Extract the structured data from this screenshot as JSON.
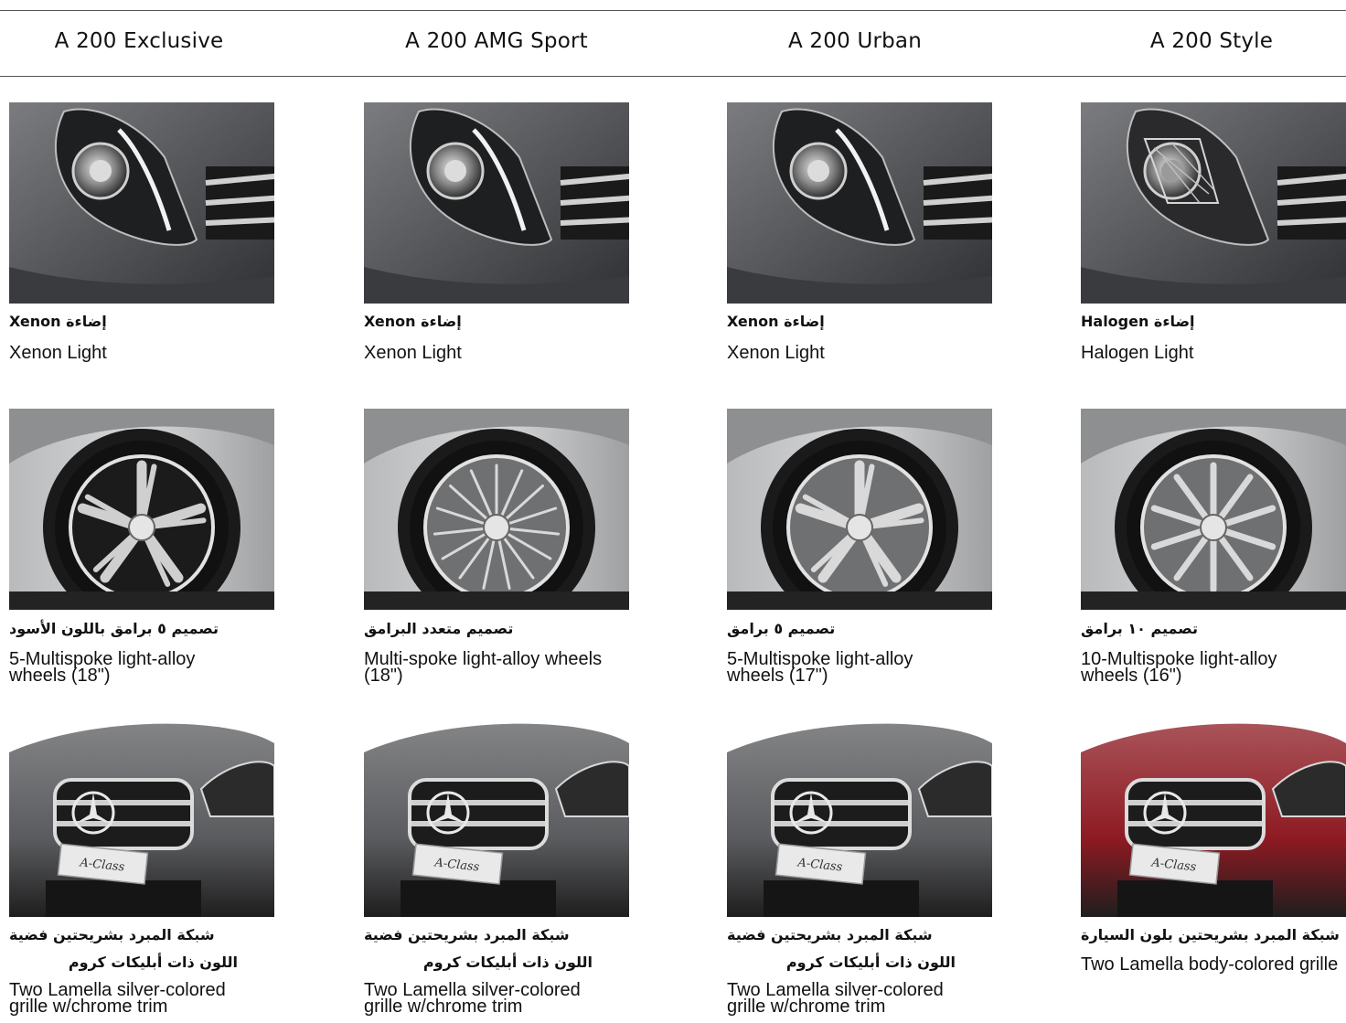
{
  "columns": [
    {
      "title": "A 200 Exclusive",
      "light_ar": "إضاءة Xenon",
      "light_en": "Xenon Light",
      "light_type": "xenon",
      "wheel_ar": "تصميم ٥ برامق  باللون الأسود",
      "wheel_en": "5-Multispoke light-alloy\nwheels (18\")",
      "wheel_type": "black-5-twin",
      "grille_ar_1": "شبكة المبرد بشريحتين فضية",
      "grille_ar_2": "اللون ذات أبليكات كروم",
      "grille_en": "Two Lamella silver-colored\ngrille w/chrome trim",
      "body_color": "#5a5b5e"
    },
    {
      "title": "A 200 AMG Sport",
      "light_ar": "إضاءة Xenon",
      "light_en": "Xenon Light",
      "light_type": "xenon",
      "wheel_ar": "تصميم متعدد البرامق",
      "wheel_en": "Multi-spoke light-alloy wheels\n(18\")",
      "wheel_type": "multispoke",
      "grille_ar_1": "شبكة المبرد بشريحتين فضية",
      "grille_ar_2": "اللون ذات أبليكات كروم",
      "grille_en": "Two Lamella silver-colored\ngrille w/chrome trim",
      "body_color": "#5a5b5e"
    },
    {
      "title": "A 200 Urban",
      "light_ar": "إضاءة Xenon",
      "light_en": "Xenon Light",
      "light_type": "xenon",
      "wheel_ar": "تصميم ٥ برامق",
      "wheel_en": "5-Multispoke light-alloy\nwheels (17\")",
      "wheel_type": "twin-5",
      "grille_ar_1": "شبكة المبرد بشريحتين فضية",
      "grille_ar_2": "اللون ذات أبليكات كروم",
      "grille_en": "Two Lamella silver-colored\ngrille w/chrome trim",
      "body_color": "#5a5b5e"
    },
    {
      "title": "A 200 Style",
      "light_ar": "إضاءة Halogen",
      "light_en": "Halogen Light",
      "light_type": "halogen",
      "wheel_ar": "تصميم ١٠ برامق",
      "wheel_en": "10-Multispoke light-alloy\nwheels (16\")",
      "wheel_type": "ten",
      "grille_ar_1": "شبكة المبرد بشريحتين بلون السيارة",
      "grille_ar_2": "",
      "grille_en": "Two Lamella body-colored grille",
      "body_color": "#8d1a22"
    }
  ],
  "badge_text": "A-Class"
}
